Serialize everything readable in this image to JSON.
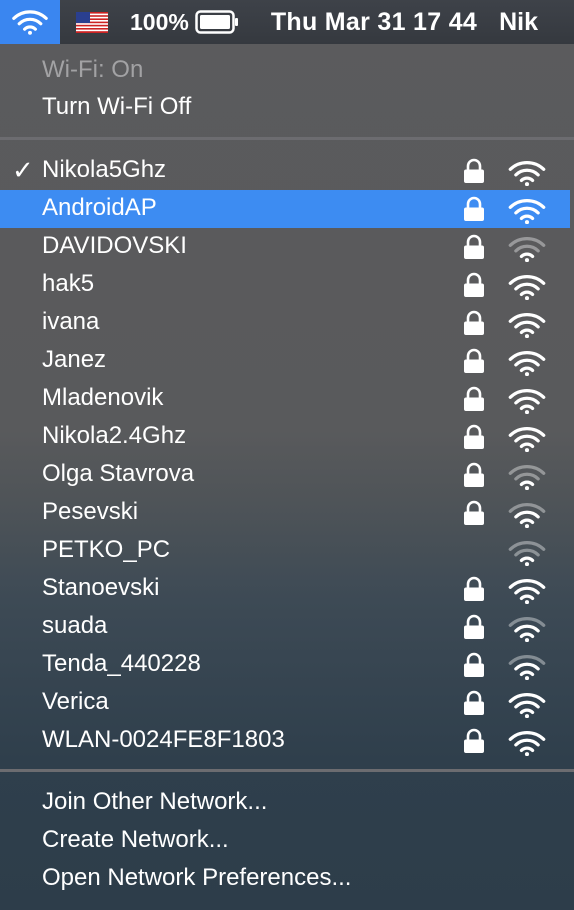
{
  "menubar": {
    "wifi_icon": "wifi-icon",
    "flag_icon": "us-flag-icon",
    "battery_percent": "100%",
    "battery_icon": "battery-icon",
    "datetime": "Thu Mar 31  17 44",
    "clipped_item": "Nik",
    "accent": "#3a86f0"
  },
  "wifi_menu": {
    "status": "Wi-Fi: On",
    "toggle_label": "Turn Wi-Fi Off",
    "networks": [
      {
        "name": "Nikola5Ghz",
        "checked": true,
        "locked": true,
        "signal": "strong"
      },
      {
        "name": "AndroidAP",
        "selected": true,
        "locked": true,
        "signal": "strong"
      },
      {
        "name": "DAVIDOVSKI",
        "locked": true,
        "signal": "weak"
      },
      {
        "name": "hak5",
        "locked": true,
        "signal": "strong"
      },
      {
        "name": "ivana",
        "locked": true,
        "signal": "strong"
      },
      {
        "name": "Janez",
        "locked": true,
        "signal": "strong"
      },
      {
        "name": "Mladenovik",
        "locked": true,
        "signal": "strong"
      },
      {
        "name": "Nikola2.4Ghz",
        "locked": true,
        "signal": "strong"
      },
      {
        "name": "Olga Stavrova",
        "locked": true,
        "signal": "weak"
      },
      {
        "name": "Pesevski",
        "locked": true,
        "signal": "medium"
      },
      {
        "name": "PETKO_PC",
        "locked": false,
        "signal": "weak"
      },
      {
        "name": "Stanoevski",
        "locked": true,
        "signal": "strong"
      },
      {
        "name": "suada",
        "locked": true,
        "signal": "medium"
      },
      {
        "name": "Tenda_440228",
        "locked": true,
        "signal": "medium"
      },
      {
        "name": "Verica",
        "locked": true,
        "signal": "strong"
      },
      {
        "name": "WLAN-0024FE8F1803",
        "locked": true,
        "signal": "strong"
      }
    ],
    "actions": {
      "join_other": "Join Other Network...",
      "create": "Create Network...",
      "preferences": "Open Network Preferences..."
    },
    "selection_color": "#3d8cf2",
    "checkmark": "✓"
  }
}
